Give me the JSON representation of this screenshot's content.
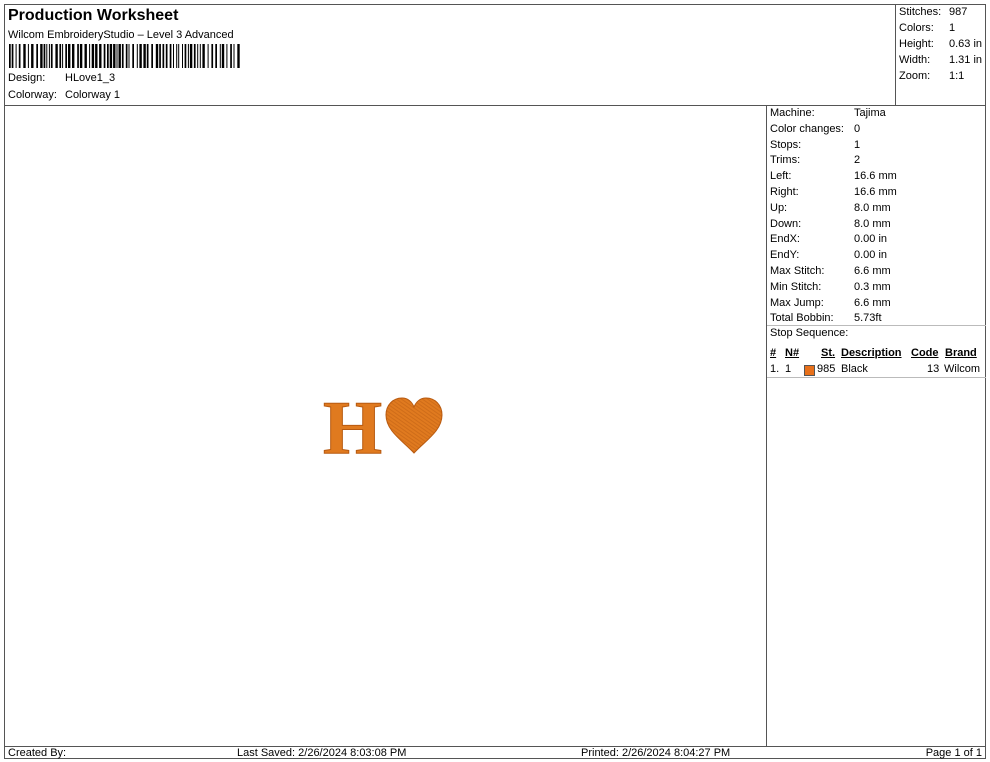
{
  "header": {
    "title": "Production Worksheet",
    "subtitle": "Wilcom EmbroideryStudio – Level 3 Advanced",
    "design_label": "Design:",
    "design_value": "HLove1_3",
    "colorway_label": "Colorway:",
    "colorway_value": "Colorway 1"
  },
  "stats": [
    {
      "label": "Stitches:",
      "value": "987"
    },
    {
      "label": "Colors:",
      "value": "1"
    },
    {
      "label": "Height:",
      "value": "0.63 in"
    },
    {
      "label": "Width:",
      "value": "1.31 in"
    },
    {
      "label": "Zoom:",
      "value": "1:1"
    }
  ],
  "properties": [
    {
      "label": "Machine:",
      "value": "Tajima"
    },
    {
      "label": "Color changes:",
      "value": "0"
    },
    {
      "label": "Stops:",
      "value": "1"
    },
    {
      "label": "Trims:",
      "value": "2"
    },
    {
      "label": "Left:",
      "value": "16.6 mm"
    },
    {
      "label": "Right:",
      "value": "16.6 mm"
    },
    {
      "label": "Up:",
      "value": "8.0 mm"
    },
    {
      "label": "Down:",
      "value": "8.0 mm"
    },
    {
      "label": "EndX:",
      "value": "0.00 in"
    },
    {
      "label": "EndY:",
      "value": "0.00 in"
    },
    {
      "label": "Max Stitch:",
      "value": "6.6 mm"
    },
    {
      "label": "Min Stitch:",
      "value": "0.3 mm"
    },
    {
      "label": "Max Jump:",
      "value": "6.6 mm"
    },
    {
      "label": "Total Bobbin:",
      "value": "5.73ft"
    }
  ],
  "stop_sequence": {
    "title": "Stop Sequence:",
    "headers": {
      "index": "#",
      "needle": "N#",
      "stitches": "St.",
      "description": "Description",
      "code": "Code",
      "brand": "Brand"
    },
    "rows": [
      {
        "index": "1.",
        "needle": "1",
        "color": "#e8701a",
        "stitches": "985",
        "description": "Black",
        "code": "13",
        "brand": "Wilcom"
      }
    ]
  },
  "design": {
    "letter": "H",
    "thread_color": "#e07a1f",
    "thread_shadow": "#b85a10"
  },
  "footer": {
    "created_by": "Created By:",
    "last_saved": "Last Saved: 2/26/2024 8:03:08 PM",
    "printed": "Printed: 2/26/2024 8:04:27 PM",
    "page": "Page 1 of 1"
  }
}
